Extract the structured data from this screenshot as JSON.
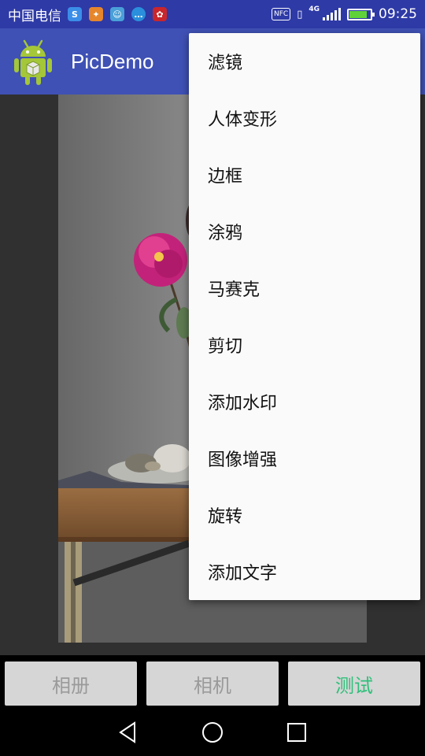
{
  "status_bar": {
    "carrier": "中国电信",
    "nfc": "NFC",
    "network": "4G",
    "time": "09:25",
    "battery_level": 0.85,
    "notification_icons": [
      "sync-icon",
      "weibo-icon",
      "android-icon",
      "message-icon",
      "huawei-icon"
    ]
  },
  "app_bar": {
    "title": "PicDemo",
    "color": "#3f51b5"
  },
  "menu": {
    "items": [
      "滤镜",
      "人体变形",
      "边框",
      "涂鸦",
      "马赛克",
      "剪切",
      "添加水印",
      "图像增强",
      "旋转",
      "添加文字"
    ]
  },
  "bottom": {
    "album_label": "相册",
    "camera_label": "相机",
    "test_label": "测试",
    "accent_color": "#2fbf7a"
  }
}
